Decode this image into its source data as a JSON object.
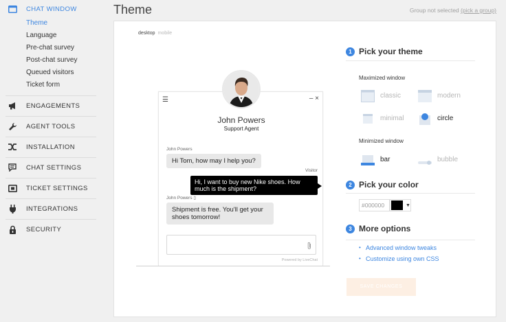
{
  "sidebar": {
    "sections": [
      {
        "label": "CHAT WINDOW",
        "icon": "window-icon",
        "active": true
      },
      {
        "label": "ENGAGEMENTS",
        "icon": "megaphone-icon"
      },
      {
        "label": "AGENT TOOLS",
        "icon": "wrench-icon"
      },
      {
        "label": "INSTALLATION",
        "icon": "merge-icon"
      },
      {
        "label": "CHAT SETTINGS",
        "icon": "chat-icon"
      },
      {
        "label": "TICKET SETTINGS",
        "icon": "ticket-icon"
      },
      {
        "label": "INTEGRATIONS",
        "icon": "plug-icon"
      },
      {
        "label": "SECURITY",
        "icon": "lock-icon"
      }
    ],
    "chat_window_items": [
      {
        "label": "Theme",
        "active": true
      },
      {
        "label": "Language"
      },
      {
        "label": "Pre-chat survey"
      },
      {
        "label": "Post-chat survey"
      },
      {
        "label": "Queued visitors"
      },
      {
        "label": "Ticket form"
      }
    ]
  },
  "header": {
    "title": "Theme",
    "group_note": "Group not selected",
    "group_link": "(pick a group)"
  },
  "preview": {
    "tab_desktop": "desktop",
    "tab_mobile": "mobile",
    "agent_name": "John Powers",
    "agent_role": "Support Agent",
    "messages": [
      {
        "author": "John Powers",
        "text": "Hi Tom, how may I help you?"
      },
      {
        "author": "Visitor",
        "text": "Hi, I want to buy new Nike shoes. How much is the shipment?"
      },
      {
        "author": "John Powers",
        "text": "Shipment is free. You'll get your shoes tomorrow!"
      }
    ],
    "powered_by": "Powered by LiveChat"
  },
  "settings": {
    "step1": {
      "num": "1",
      "title": "Pick your theme"
    },
    "maximized_label": "Maximized window",
    "maximized_options": [
      {
        "label": "classic"
      },
      {
        "label": "modern"
      },
      {
        "label": "minimal"
      },
      {
        "label": "circle",
        "selected": true
      }
    ],
    "minimized_label": "Minimized window",
    "minimized_options": [
      {
        "label": "bar",
        "selected": true
      },
      {
        "label": "bubble"
      }
    ],
    "step2": {
      "num": "2",
      "title": "Pick your color"
    },
    "color_value": "#000000",
    "step3": {
      "num": "3",
      "title": "More options"
    },
    "links": [
      "Advanced window tweaks",
      "Customize using own CSS"
    ],
    "save_label": "SAVE CHANGES"
  },
  "colors": {
    "accent": "#3d86e0",
    "selected_color": "#000000"
  }
}
